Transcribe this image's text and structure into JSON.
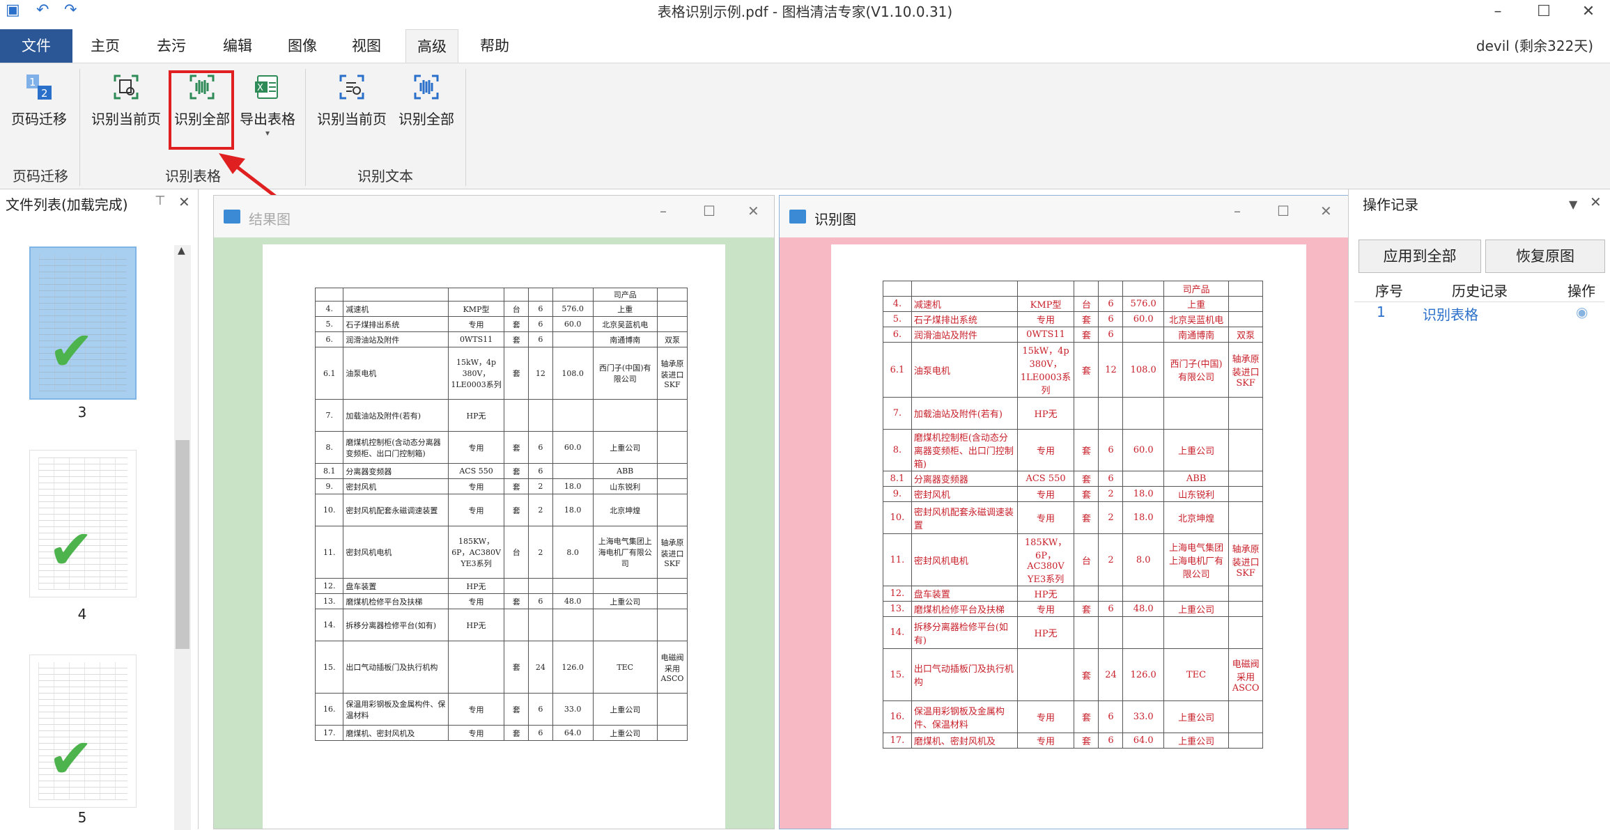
{
  "window": {
    "title": "表格识别示例.pdf - 图档清洁专家(V1.10.0.31)",
    "minimize": "–",
    "maximize": "☐",
    "close": "✕"
  },
  "menu": {
    "file": "文件",
    "tabs": [
      "主页",
      "去污",
      "编辑",
      "图像",
      "视图",
      "高级",
      "帮助"
    ],
    "active_tab": "高级",
    "user": "devil (剩余322天)"
  },
  "ribbon": {
    "buttons": [
      "页码迁移",
      "识别当前页",
      "识别全部",
      "导出表格",
      "识别当前页",
      "识别全部"
    ],
    "groups": [
      "页码迁移",
      "识别表格",
      "识别文本"
    ]
  },
  "file_panel": {
    "title": "文件列表(加载完成)",
    "pages": [
      "3",
      "4",
      "5"
    ]
  },
  "result_window": {
    "title": "结果图"
  },
  "recog_window": {
    "title": "识别图"
  },
  "table": {
    "header_note": "司产品",
    "rows": [
      {
        "no": "4.",
        "name": "减速机",
        "spec": "KMP型",
        "unit": "台",
        "qty": "6",
        "price": "576.0",
        "maker": "上重",
        "note": ""
      },
      {
        "no": "5.",
        "name": "石子煤排出系统",
        "spec": "专用",
        "unit": "套",
        "qty": "6",
        "price": "60.0",
        "maker": "北京吴蓝机电",
        "note": ""
      },
      {
        "no": "6.",
        "name": "润滑油站及附件",
        "spec": "0WTS11",
        "unit": "套",
        "qty": "6",
        "price": "",
        "maker": "南通博南",
        "note": "双泵"
      },
      {
        "no": "6.1",
        "name": "油泵电机",
        "spec": "15kW，4p 380V，1LE0003系列",
        "unit": "套",
        "qty": "12",
        "price": "108.0",
        "maker": "西门子(中国)有限公司",
        "note": "轴承原装进口SKF"
      },
      {
        "no": "7.",
        "name": "加载油站及附件(若有)",
        "spec": "HP无",
        "unit": "",
        "qty": "",
        "price": "",
        "maker": "",
        "note": ""
      },
      {
        "no": "8.",
        "name": "磨煤机控制柜(含动态分离器变频柜、出口门控制箱)",
        "spec": "专用",
        "unit": "套",
        "qty": "6",
        "price": "60.0",
        "maker": "上重公司",
        "note": ""
      },
      {
        "no": "8.1",
        "name": "分离器变频器",
        "spec": "ACS 550",
        "unit": "套",
        "qty": "6",
        "price": "",
        "maker": "ABB",
        "note": ""
      },
      {
        "no": "9.",
        "name": "密封风机",
        "spec": "专用",
        "unit": "套",
        "qty": "2",
        "price": "18.0",
        "maker": "山东锐利",
        "note": ""
      },
      {
        "no": "10.",
        "name": "密封风机配套永磁调速装置",
        "spec": "专用",
        "unit": "套",
        "qty": "2",
        "price": "18.0",
        "maker": "北京坤煌",
        "note": ""
      },
      {
        "no": "11.",
        "name": "密封风机电机",
        "spec": "185KW，6P，AC380V YE3系列",
        "unit": "台",
        "qty": "2",
        "price": "8.0",
        "maker": "上海电气集团上海电机厂有限公司",
        "note": "轴承原装进口SKF"
      },
      {
        "no": "12.",
        "name": "盘车装置",
        "spec": "HP无",
        "unit": "",
        "qty": "",
        "price": "",
        "maker": "",
        "note": ""
      },
      {
        "no": "13.",
        "name": "磨煤机检修平台及扶梯",
        "spec": "专用",
        "unit": "套",
        "qty": "6",
        "price": "48.0",
        "maker": "上重公司",
        "note": ""
      },
      {
        "no": "14.",
        "name": "拆移分离器检修平台(如有)",
        "spec": "HP无",
        "unit": "",
        "qty": "",
        "price": "",
        "maker": "",
        "note": ""
      },
      {
        "no": "15.",
        "name": "出口气动插板门及执行机构",
        "spec": "",
        "unit": "套",
        "qty": "24",
        "price": "126.0",
        "maker": "TEC",
        "note": "电磁阀采用ASCO"
      },
      {
        "no": "16.",
        "name": "保温用彩钢板及金属构件、保温材料",
        "spec": "专用",
        "unit": "套",
        "qty": "6",
        "price": "33.0",
        "maker": "上重公司",
        "note": ""
      },
      {
        "no": "17.",
        "name": "磨煤机、密封风机及",
        "spec": "专用",
        "unit": "套",
        "qty": "6",
        "price": "64.0",
        "maker": "上重公司",
        "note": ""
      }
    ]
  },
  "ops_panel": {
    "title": "操作记录",
    "apply_all": "应用到全部",
    "restore": "恢复原图",
    "headers": [
      "序号",
      "历史记录",
      "操作"
    ],
    "history": [
      {
        "idx": "1",
        "record": "识别表格"
      }
    ]
  },
  "colors": {
    "accent": "#2b5797",
    "highlight_box": "#e02020",
    "result_bg": "#c9e3c6",
    "recog_bg": "#f7b9c4",
    "check": "#4db34d"
  }
}
